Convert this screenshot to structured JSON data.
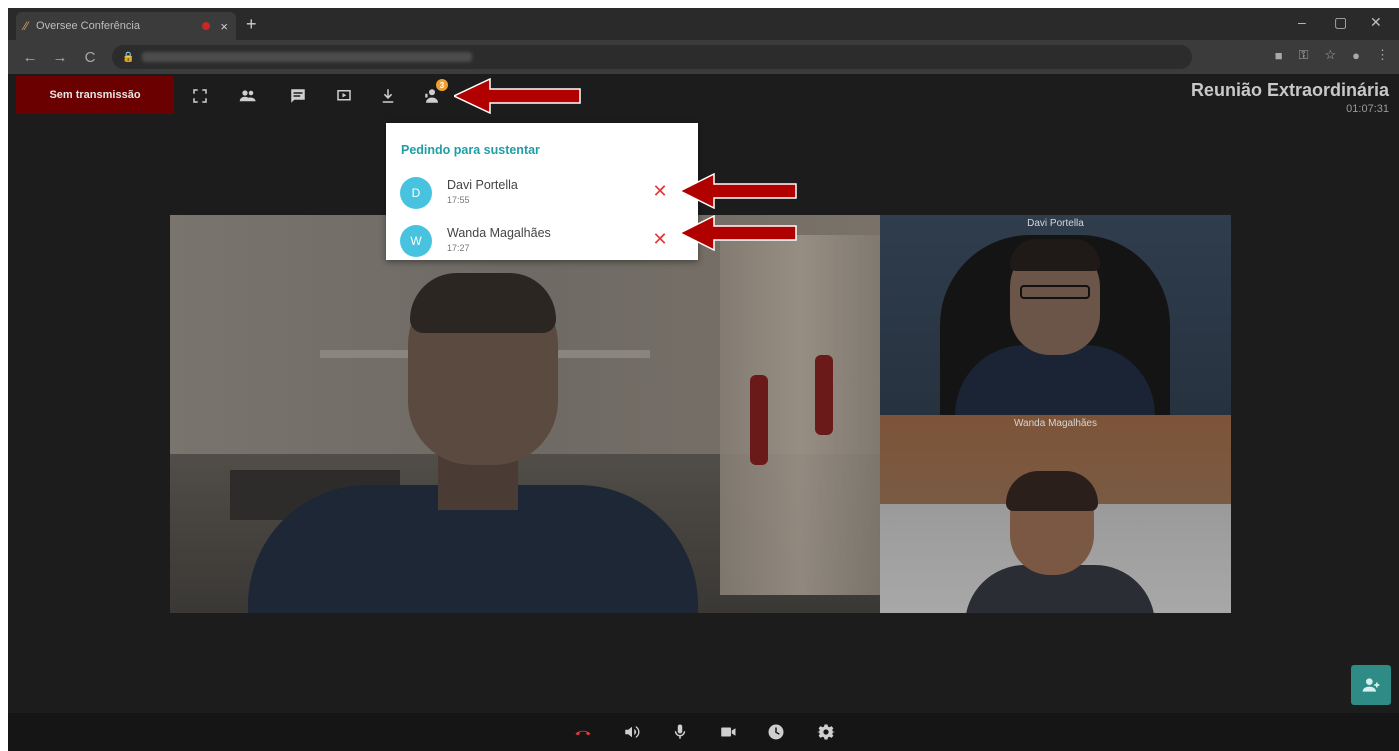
{
  "browser": {
    "tab_title": "Oversee Conferência",
    "tab_close": "×",
    "new_tab": "+",
    "minimize": "–",
    "maximize": "▢",
    "close": "✕",
    "back": "←",
    "forward": "→",
    "reload": "C"
  },
  "toolbar": {
    "transmission_label": "Sem transmissão",
    "requests_badge": "3",
    "meeting_title": "Reunião Extraordinária",
    "elapsed": "01:07:31"
  },
  "requests_panel": {
    "title": "Pedindo para sustentar",
    "items": [
      {
        "initial": "D",
        "name": "Davi Portella",
        "time": "17:55"
      },
      {
        "initial": "W",
        "name": "Wanda Magalhães",
        "time": "17:27"
      }
    ],
    "remove_glyph": "✕"
  },
  "videos": {
    "side1_name": "Davi Portella",
    "side2_name": "Wanda Magalhães"
  },
  "colors": {
    "live_button": "#6b0000",
    "accent": "#1e9fa6",
    "avatar": "#47c3e0",
    "remove": "#e53935",
    "fab": "#2e8b86",
    "annotation_arrow": "#b00000"
  }
}
